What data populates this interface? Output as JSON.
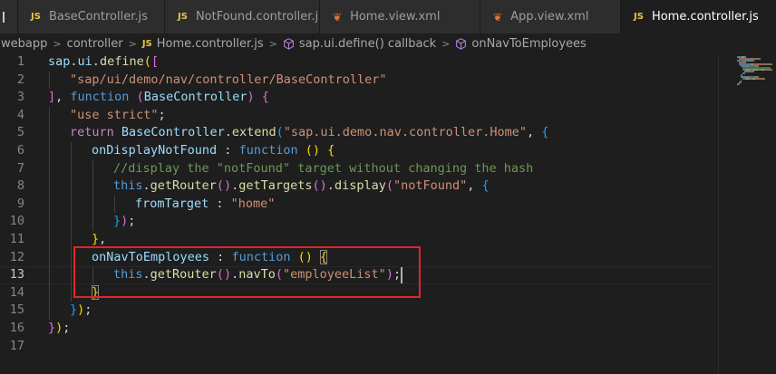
{
  "tabs": [
    {
      "name": "partial-tab",
      "label": "",
      "type": "",
      "active": false
    },
    {
      "name": "tab-basecontroller-js",
      "label": "BaseController.js",
      "type": "JS",
      "active": false
    },
    {
      "name": "tab-notfound-controller-js",
      "label": "NotFound.controller.js",
      "type": "JS",
      "active": false
    },
    {
      "name": "tab-home-view-xml",
      "label": "Home.view.xml",
      "type": "xml",
      "active": false
    },
    {
      "name": "tab-app-view-xml",
      "label": "App.view.xml",
      "type": "xml",
      "active": false
    },
    {
      "name": "tab-home-controller-js",
      "label": "Home.controller.js",
      "type": "JS",
      "active": true
    }
  ],
  "breadcrumb": {
    "items": [
      {
        "label": "webapp",
        "icon": ""
      },
      {
        "label": "controller",
        "icon": ""
      },
      {
        "label": "Home.controller.js",
        "icon": "JS"
      },
      {
        "label": "sap.ui.define() callback",
        "icon": "cube-icon"
      },
      {
        "label": "onNavToEmployees",
        "icon": "cube-icon"
      }
    ]
  },
  "editor": {
    "current_line": 13,
    "line_numbers": [
      "1",
      "2",
      "3",
      "4",
      "5",
      "6",
      "7",
      "8",
      "9",
      "10",
      "11",
      "12",
      "13",
      "14",
      "15",
      "16",
      "17"
    ],
    "lines": [
      {
        "indent": 0,
        "tokens": [
          [
            "var",
            "sap"
          ],
          [
            "default",
            "."
          ],
          [
            "var",
            "ui"
          ],
          [
            "default",
            "."
          ],
          [
            "fn",
            "define"
          ],
          [
            "bracket1",
            "("
          ],
          [
            "bracket2",
            "["
          ]
        ]
      },
      {
        "indent": 1,
        "tokens": [
          [
            "str",
            "\"sap/ui/demo/nav/controller/BaseController\""
          ]
        ]
      },
      {
        "indent": 0,
        "tokens": [
          [
            "bracket2",
            "]"
          ],
          [
            "default",
            ", "
          ],
          [
            "kw",
            "function"
          ],
          [
            "default",
            " "
          ],
          [
            "bracket2",
            "("
          ],
          [
            "var",
            "BaseController"
          ],
          [
            "bracket2",
            ")"
          ],
          [
            "default",
            " "
          ],
          [
            "bracket2",
            "{"
          ]
        ]
      },
      {
        "indent": 1,
        "tokens": [
          [
            "str",
            "\"use strict\""
          ],
          [
            "default",
            ";"
          ]
        ]
      },
      {
        "indent": 1,
        "tokens": [
          [
            "ctrl",
            "return"
          ],
          [
            "default",
            " "
          ],
          [
            "var",
            "BaseController"
          ],
          [
            "default",
            "."
          ],
          [
            "fn",
            "extend"
          ],
          [
            "bracket3",
            "("
          ],
          [
            "str",
            "\"sap.ui.demo.nav.controller.Home\""
          ],
          [
            "default",
            ", "
          ],
          [
            "bracket3",
            "{"
          ]
        ]
      },
      {
        "indent": 2,
        "tokens": [
          [
            "var",
            "onDisplayNotFound"
          ],
          [
            "default",
            " : "
          ],
          [
            "kw",
            "function"
          ],
          [
            "default",
            " "
          ],
          [
            "bracket1",
            "("
          ],
          [
            "bracket1",
            ")"
          ],
          [
            "default",
            " "
          ],
          [
            "bracket1",
            "{"
          ]
        ]
      },
      {
        "indent": 3,
        "tokens": [
          [
            "comment",
            "//display the \"notFound\" target without changing the hash"
          ]
        ]
      },
      {
        "indent": 3,
        "tokens": [
          [
            "kw",
            "this"
          ],
          [
            "default",
            "."
          ],
          [
            "fn",
            "getRouter"
          ],
          [
            "bracket2",
            "("
          ],
          [
            "bracket2",
            ")"
          ],
          [
            "default",
            "."
          ],
          [
            "fn",
            "getTargets"
          ],
          [
            "bracket2",
            "("
          ],
          [
            "bracket2",
            ")"
          ],
          [
            "default",
            "."
          ],
          [
            "fn",
            "display"
          ],
          [
            "bracket2",
            "("
          ],
          [
            "str",
            "\"notFound\""
          ],
          [
            "default",
            ", "
          ],
          [
            "bracket3",
            "{"
          ]
        ]
      },
      {
        "indent": 4,
        "tokens": [
          [
            "var",
            "fromTarget"
          ],
          [
            "default",
            " : "
          ],
          [
            "str",
            "\"home\""
          ]
        ]
      },
      {
        "indent": 3,
        "tokens": [
          [
            "bracket3",
            "}"
          ],
          [
            "bracket2",
            ")"
          ],
          [
            "default",
            ";"
          ]
        ]
      },
      {
        "indent": 2,
        "tokens": [
          [
            "bracket1",
            "}"
          ],
          [
            "default",
            ","
          ]
        ]
      },
      {
        "indent": 2,
        "tokens": [
          [
            "var",
            "onNavToEmployees"
          ],
          [
            "default",
            " : "
          ],
          [
            "kw",
            "function"
          ],
          [
            "default",
            " "
          ],
          [
            "bracket1",
            "("
          ],
          [
            "bracket1",
            ")"
          ],
          [
            "default",
            " "
          ],
          [
            "bracket1m",
            "{"
          ]
        ]
      },
      {
        "indent": 3,
        "tokens": [
          [
            "kw",
            "this"
          ],
          [
            "default",
            "."
          ],
          [
            "fn",
            "getRouter"
          ],
          [
            "bracket2",
            "("
          ],
          [
            "bracket2",
            ")"
          ],
          [
            "default",
            "."
          ],
          [
            "fn",
            "navTo"
          ],
          [
            "bracket2",
            "("
          ],
          [
            "str",
            "\"employeeList\""
          ],
          [
            "bracket2",
            ")"
          ],
          [
            "default",
            ";"
          ]
        ]
      },
      {
        "indent": 2,
        "tokens": [
          [
            "bracket1m",
            "}"
          ]
        ]
      },
      {
        "indent": 1,
        "tokens": [
          [
            "bracket3",
            "}"
          ],
          [
            "bracket1",
            ")"
          ],
          [
            "default",
            ";"
          ]
        ]
      },
      {
        "indent": 0,
        "tokens": [
          [
            "bracket2",
            "}"
          ],
          [
            "bracket1",
            ")"
          ],
          [
            "default",
            ";"
          ]
        ]
      },
      {
        "indent": 0,
        "tokens": []
      }
    ]
  },
  "colors": {
    "background": "#1e1e1e",
    "tab_inactive": "#2d2d2d",
    "annotation_box": "#e3232b",
    "js_icon": "#e8c54a",
    "xml_icon": "#e37933"
  }
}
